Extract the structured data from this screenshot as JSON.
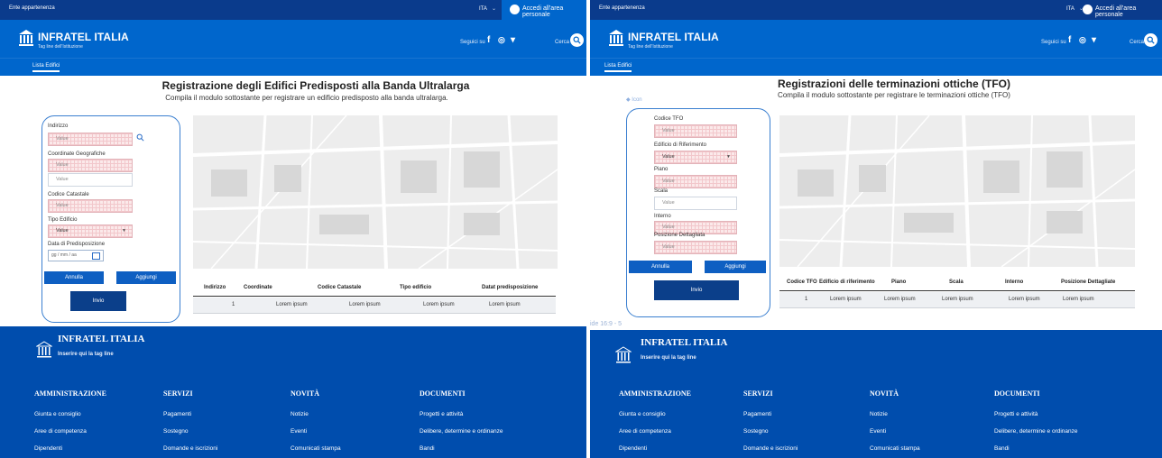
{
  "common": {
    "ente": "Ente appartenenza",
    "lang": "ITA",
    "login": "Accedi all'area personale",
    "brand": "INFRATEL ITALIA",
    "tagline": "Tag line dell'Istituzione",
    "social_label": "Seguici su",
    "social_icons": [
      "f",
      "◎",
      "▾"
    ],
    "search_label": "Cerca",
    "nav_tab": "Lista Edifici"
  },
  "left": {
    "title": "Registrazione degli Edifici Predisposti alla Banda Ultralarga",
    "subtitle": "Compila il modulo sottostante per registrare un edificio predisposto alla banda ultralarga.",
    "form": {
      "indirizzo_label": "Indirizzo",
      "indirizzo_value": "Value",
      "coordinate_label": "Coordinate Geografiche",
      "coordinate_value1": "Value",
      "coordinate_value2": "Value",
      "catastale_label": "Codice Catastale",
      "catastale_value": "Value",
      "tipo_label": "Tipo Edificio",
      "tipo_value": "Value",
      "data_label": "Data di Predisposizione",
      "data_value": "gg / mm / aa",
      "annulla": "Annulla",
      "aggiungi": "Aggiungi",
      "invio": "Invio"
    },
    "table": {
      "headers": [
        "Indirizzo",
        "Coordinate",
        "Codice Catastale",
        "Tipo edificio",
        "Datat predisposizione"
      ],
      "row": [
        "1",
        "Lorem ipsum",
        "Lorem ipsum",
        "Lorem ipsum",
        "Lorem ipsum"
      ]
    }
  },
  "right": {
    "title": "Registrazioni delle terminazioni ottiche (TFO)",
    "subtitle": "Compila il modulo sottostante per registrare le terminazioni ottiche (TFO)",
    "icon_label": "Icon",
    "form": {
      "codice_label": "Codice TFO",
      "codice_value": "Value",
      "edificio_label": "Edificio di Riferimento",
      "edificio_value": "Value",
      "piano_label": "Piano",
      "piano_value": "Value",
      "scala_label": "Scala",
      "scala_value": "Value",
      "interno_label": "Interno",
      "interno_value": "Value",
      "posizione_label": "Posizione Dettagliata",
      "posizione_value": "Value",
      "annulla": "Annulla",
      "aggiungi": "Aggiungi",
      "invio": "Invio"
    },
    "table": {
      "headers": [
        "Codice TFO",
        "Edificio di riferimento",
        "Piano",
        "Scala",
        "Interno",
        "Posizione Dettagliate"
      ],
      "row": [
        "1",
        "Lorem ipsum",
        "Lorem ipsum",
        "Lorem ipsum",
        "Lorem ipsum",
        "Lorem ipsum"
      ]
    },
    "slide_label": "ide 16:9 - 5"
  },
  "footer": {
    "brand": "INFRATEL ITALIA",
    "tagline": "Inserire qui la tag line",
    "columns": [
      {
        "title": "AMMINISTRAZIONE",
        "links": [
          "Giunta e consiglio",
          "Aree di competenza",
          "Dipendenti"
        ]
      },
      {
        "title": "SERVIZI",
        "links": [
          "Pagamenti",
          "Sostegno",
          "Domande e iscrizioni"
        ]
      },
      {
        "title": "NOVITÀ",
        "links": [
          "Notizie",
          "Eventi",
          "Comunicati stampa"
        ]
      },
      {
        "title": "DOCUMENTI",
        "links": [
          "Progetti e attività",
          "Delibere, determine e ordinanze",
          "Bandi"
        ]
      }
    ]
  },
  "colors": {
    "primary": "#0066cc",
    "dark": "#0a3b8c",
    "footer": "#004dad"
  }
}
